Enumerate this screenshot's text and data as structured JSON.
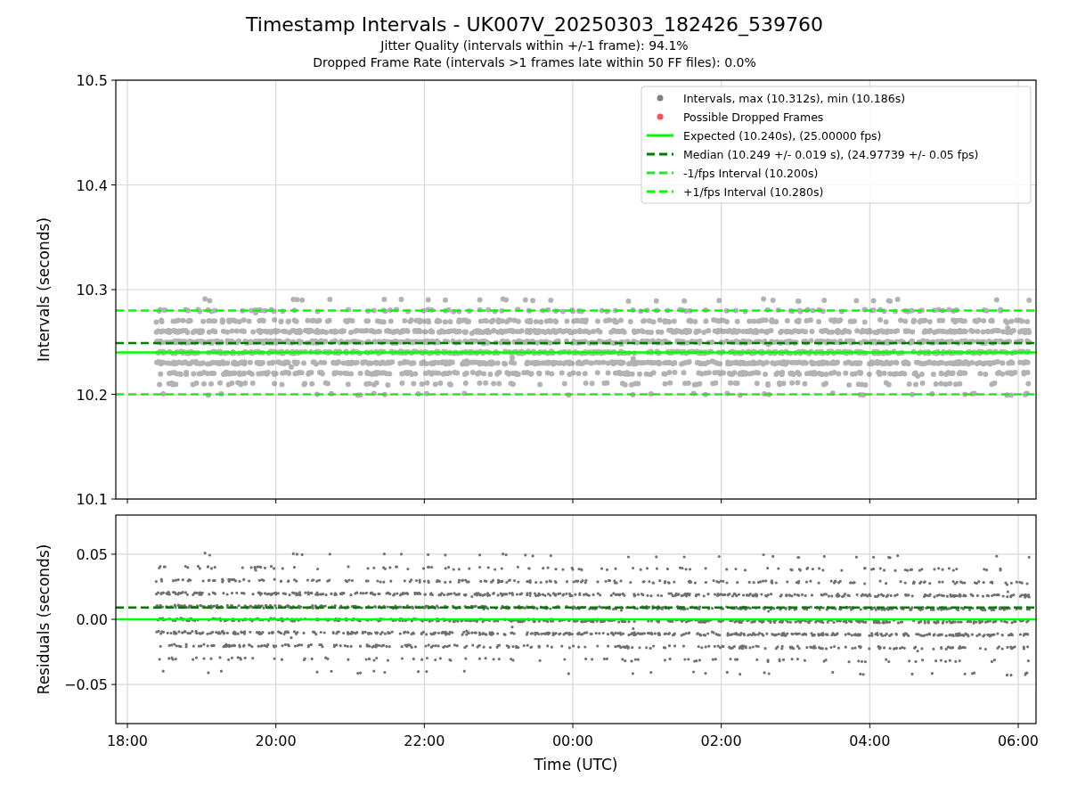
{
  "figure": {
    "title": "Timestamp Intervals - UK007V_20250303_182426_539760",
    "subtitles": [
      "Jitter Quality (intervals within +/-1 frame): 94.1%",
      "Dropped Frame Rate (intervals >1 frames late within 50 FF files): 0.0%"
    ]
  },
  "panels": [
    {
      "legend_markers": [
        {
          "label": "Intervals, max (10.312s), min (10.186s)",
          "color": "#808080"
        },
        {
          "label": "Possible Dropped Frames",
          "color": "#ff5050"
        }
      ],
      "chart_data": {
        "type": "scatter",
        "legend": "upper right",
        "ylabel": "Intervals (seconds)",
        "categories": [
          null,
          null,
          null,
          null,
          null,
          null,
          null
        ],
        "grid": true,
        "ylim": [
          10.1,
          10.5
        ],
        "yticks": [
          {
            "value": 10.1,
            "label": "10.1"
          },
          {
            "value": 10.2,
            "label": "10.2"
          },
          {
            "value": 10.3,
            "label": "10.3"
          },
          {
            "value": 10.4,
            "label": "10.4"
          },
          {
            "value": 10.5,
            "label": "10.5"
          }
        ],
        "ref_lines": [
          {
            "axis": "y",
            "value": 10.24,
            "label": "Expected (10.240s), (25.00000 fps)",
            "color": "#00ff00"
          },
          {
            "axis": "y",
            "value": 10.249,
            "label": "Median (10.249 +/- 0.019 s), (24.97739 +/- 0.05 fps)",
            "color": "#007a00"
          },
          {
            "axis": "y",
            "value": 10.2,
            "label": "-1/fps Interval (10.200s)",
            "color": "#32dd32"
          },
          {
            "axis": "y",
            "value": 10.28,
            "label": "+1/fps Interval (10.280s)",
            "color": "#00ff00"
          }
        ]
      }
    },
    {
      "chart_data": {
        "type": "scatter",
        "xlabel": "Time (UTC)",
        "ylabel": "Residuals (seconds)",
        "categories": [
          "18:00",
          "20:00",
          "22:00",
          "00:00",
          "02:00",
          "04:00",
          "06:00"
        ],
        "grid": true,
        "ylim": [
          -0.08,
          0.08
        ],
        "yticks": [
          {
            "value": -0.05,
            "label": "−0.05"
          },
          {
            "value": 0,
            "label": "0.00"
          },
          {
            "value": 0.05,
            "label": "0.05"
          }
        ],
        "ref_lines": [
          {
            "axis": "y",
            "value": 0.009,
            "color": "#007a00"
          },
          {
            "axis": "y",
            "value": 0,
            "color": "#00ff00"
          }
        ]
      }
    }
  ]
}
